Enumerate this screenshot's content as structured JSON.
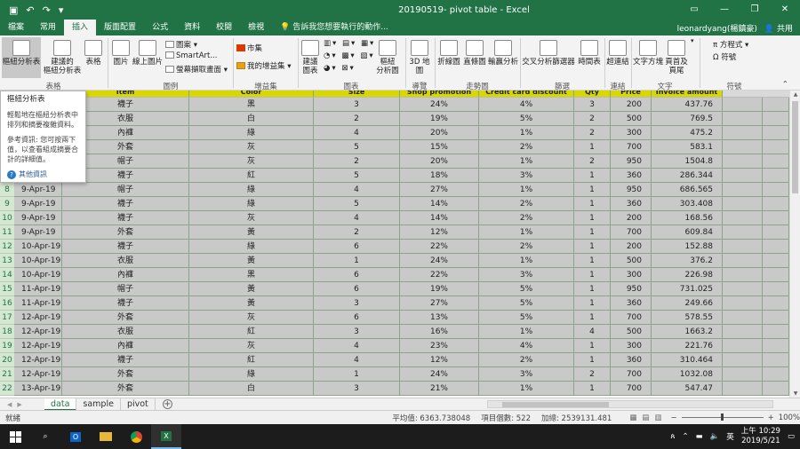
{
  "window": {
    "title": "20190519- pivot table - Excel",
    "user": "leonardyang(楊鎮豪)",
    "share": "共用"
  },
  "tabs": [
    "檔案",
    "常用",
    "插入",
    "版面配置",
    "公式",
    "資料",
    "校閱",
    "檢視"
  ],
  "active_tab": "插入",
  "tell_me": "告訴我您想要執行的動作...",
  "ribbon": {
    "pivot": "樞紐分析表",
    "rec_pivot": "建議的\n樞紐分析表",
    "table": "表格",
    "pictures": "圖片",
    "online_pictures": "線上圖片",
    "shapes": "圖案",
    "smartart": "SmartArt...",
    "screenshot": "螢幕擷取畫面",
    "store": "市集",
    "my_addins": "我的增益集",
    "rec_charts": "建議\n圖表",
    "pivot_chart": "樞紐\n分析圖",
    "map3d": "3D 地\n圖",
    "line": "折線圖",
    "column": "直條圖",
    "winloss": "輸贏分析",
    "slicer": "交叉分析篩選器",
    "timeline": "時間表",
    "hyperlink": "超連結",
    "textbox": "文字方塊",
    "header_footer": "頁首及\n頁尾",
    "equation": "方程式",
    "symbol": "符號",
    "groups": {
      "tables": "表格",
      "illustrations": "圖例",
      "addins": "增益集",
      "charts": "圖表",
      "tours": "導覽",
      "sparklines": "走勢圖",
      "filters": "篩選",
      "links": "連結",
      "text": "文字",
      "symbols": "符號"
    }
  },
  "tooltip": {
    "title": "樞紐分析表",
    "p1": "輕鬆地在樞紐分析表中排列和摘要複雜資料。",
    "p2": "參考資訊: 您可按兩下值，以查看組成摘要合計的詳細值。",
    "more": "其他資訊"
  },
  "headers": [
    "Item",
    "Color",
    "Size",
    "Shop promotion",
    "Credit card discount",
    "Qty",
    "Price",
    "Invoice amount"
  ],
  "rows": [
    {
      "r": "",
      "date": "",
      "item": "襪子",
      "color": "黑",
      "size": "3",
      "shop": "24%",
      "credit": "4%",
      "qty": "3",
      "price": "200",
      "amount": "437.76"
    },
    {
      "r": "",
      "date": "",
      "item": "衣服",
      "color": "白",
      "size": "2",
      "shop": "19%",
      "credit": "5%",
      "qty": "2",
      "price": "500",
      "amount": "769.5"
    },
    {
      "r": "",
      "date": "",
      "item": "內褲",
      "color": "綠",
      "size": "4",
      "shop": "20%",
      "credit": "1%",
      "qty": "2",
      "price": "300",
      "amount": "475.2"
    },
    {
      "r": "",
      "date": "",
      "item": "外套",
      "color": "灰",
      "size": "5",
      "shop": "15%",
      "credit": "2%",
      "qty": "1",
      "price": "700",
      "amount": "583.1"
    },
    {
      "r": "",
      "date": "",
      "item": "帽子",
      "color": "灰",
      "size": "2",
      "shop": "20%",
      "credit": "1%",
      "qty": "2",
      "price": "950",
      "amount": "1504.8"
    },
    {
      "r": "",
      "date": "",
      "item": "襪子",
      "color": "紅",
      "size": "5",
      "shop": "18%",
      "credit": "3%",
      "qty": "1",
      "price": "360",
      "amount": "286.344"
    },
    {
      "r": "8",
      "date": "9-Apr-19",
      "item": "帽子",
      "color": "綠",
      "size": "4",
      "shop": "27%",
      "credit": "1%",
      "qty": "1",
      "price": "950",
      "amount": "686.565"
    },
    {
      "r": "9",
      "date": "9-Apr-19",
      "item": "襪子",
      "color": "綠",
      "size": "5",
      "shop": "14%",
      "credit": "2%",
      "qty": "1",
      "price": "360",
      "amount": "303.408"
    },
    {
      "r": "10",
      "date": "9-Apr-19",
      "item": "襪子",
      "color": "灰",
      "size": "4",
      "shop": "14%",
      "credit": "2%",
      "qty": "1",
      "price": "200",
      "amount": "168.56"
    },
    {
      "r": "11",
      "date": "9-Apr-19",
      "item": "外套",
      "color": "黃",
      "size": "2",
      "shop": "12%",
      "credit": "1%",
      "qty": "1",
      "price": "700",
      "amount": "609.84"
    },
    {
      "r": "12",
      "date": "10-Apr-19",
      "item": "襪子",
      "color": "綠",
      "size": "6",
      "shop": "22%",
      "credit": "2%",
      "qty": "1",
      "price": "200",
      "amount": "152.88"
    },
    {
      "r": "13",
      "date": "10-Apr-19",
      "item": "衣服",
      "color": "黃",
      "size": "1",
      "shop": "24%",
      "credit": "1%",
      "qty": "1",
      "price": "500",
      "amount": "376.2"
    },
    {
      "r": "14",
      "date": "10-Apr-19",
      "item": "內褲",
      "color": "黑",
      "size": "6",
      "shop": "22%",
      "credit": "3%",
      "qty": "1",
      "price": "300",
      "amount": "226.98"
    },
    {
      "r": "15",
      "date": "11-Apr-19",
      "item": "帽子",
      "color": "黃",
      "size": "6",
      "shop": "19%",
      "credit": "5%",
      "qty": "1",
      "price": "950",
      "amount": "731.025"
    },
    {
      "r": "16",
      "date": "11-Apr-19",
      "item": "襪子",
      "color": "黃",
      "size": "3",
      "shop": "27%",
      "credit": "5%",
      "qty": "1",
      "price": "360",
      "amount": "249.66"
    },
    {
      "r": "17",
      "date": "12-Apr-19",
      "item": "外套",
      "color": "灰",
      "size": "6",
      "shop": "13%",
      "credit": "5%",
      "qty": "1",
      "price": "700",
      "amount": "578.55"
    },
    {
      "r": "18",
      "date": "12-Apr-19",
      "item": "衣服",
      "color": "紅",
      "size": "3",
      "shop": "16%",
      "credit": "1%",
      "qty": "4",
      "price": "500",
      "amount": "1663.2"
    },
    {
      "r": "19",
      "date": "12-Apr-19",
      "item": "內褲",
      "color": "灰",
      "size": "4",
      "shop": "23%",
      "credit": "4%",
      "qty": "1",
      "price": "300",
      "amount": "221.76"
    },
    {
      "r": "20",
      "date": "12-Apr-19",
      "item": "襪子",
      "color": "紅",
      "size": "4",
      "shop": "12%",
      "credit": "2%",
      "qty": "1",
      "price": "360",
      "amount": "310.464"
    },
    {
      "r": "21",
      "date": "12-Apr-19",
      "item": "外套",
      "color": "綠",
      "size": "1",
      "shop": "24%",
      "credit": "3%",
      "qty": "2",
      "price": "700",
      "amount": "1032.08"
    },
    {
      "r": "22",
      "date": "13-Apr-19",
      "item": "外套",
      "color": "白",
      "size": "3",
      "shop": "21%",
      "credit": "1%",
      "qty": "1",
      "price": "700",
      "amount": "547.47"
    }
  ],
  "sheets": [
    "data",
    "sample",
    "pivot"
  ],
  "active_sheet": "data",
  "status": {
    "ready": "就緒",
    "average": "平均值: 6363.738048",
    "count": "項目個數: 522",
    "sum": "加總: 2539131.481",
    "zoom": "100%"
  },
  "clock": {
    "time": "上午 10:29",
    "date": "2019/5/21"
  },
  "colors": {
    "excel_green": "#217346",
    "cell_fill": "#c9c9c9",
    "header_yellow": "#d8d800"
  }
}
